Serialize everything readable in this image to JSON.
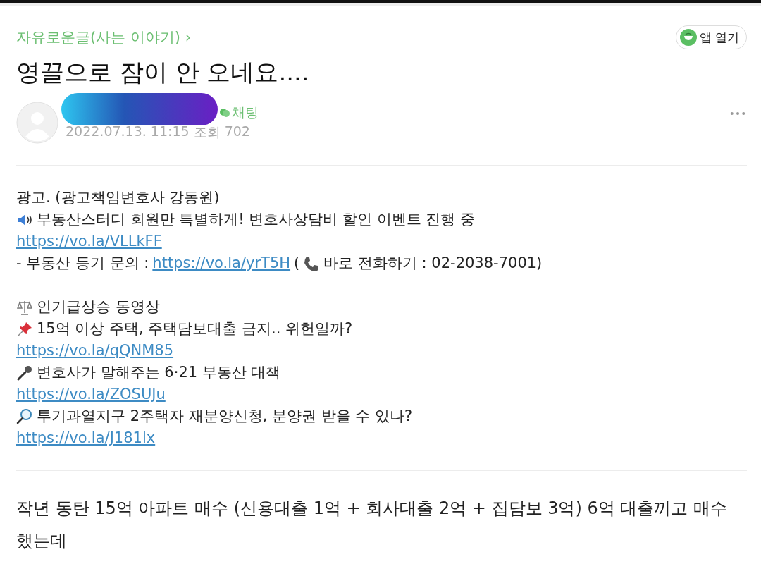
{
  "breadcrumb": "자유로운글(사는 이야기) ›",
  "app_button": "앱 열기",
  "title": "영끌으로 잠이 안 오네요....",
  "author": {
    "chat": "채팅",
    "date": "2022.07.13. 11:15",
    "views_label": "조회",
    "views": "702"
  },
  "ad_blocks": [
    [
      {
        "segments": [
          {
            "kind": "text",
            "text": "광고. (광고책임변호사 강동원)"
          }
        ]
      },
      {
        "segments": [
          {
            "kind": "icon"
          },
          {
            "kind": "text",
            "text": "부동산스터디 회원만 특별하게! 변호사상담비 할인 이벤트 진행 중"
          }
        ]
      },
      {
        "segments": [
          {
            "kind": "link",
            "text": "https://vo.la/VLLkFF"
          }
        ]
      },
      {
        "segments": [
          {
            "kind": "text",
            "text": "- 부동산 등기 문의 :"
          },
          {
            "kind": "link",
            "text": "https://vo.la/yrT5H"
          },
          {
            "kind": "text",
            "text": "("
          },
          {
            "kind": "icon"
          },
          {
            "kind": "text",
            "text": "바로 전화하기 : 02-2038-7001)"
          }
        ]
      }
    ],
    [
      {
        "segments": [
          {
            "kind": "icon"
          },
          {
            "kind": "text",
            "text": "인기급상승 동영상"
          }
        ]
      },
      {
        "segments": [
          {
            "kind": "icon"
          },
          {
            "kind": "text",
            "text": "15억 이상 주택, 주택담보대출 금지.. 위헌일까?"
          }
        ]
      },
      {
        "segments": [
          {
            "kind": "link",
            "text": "https://vo.la/qQNM85"
          }
        ]
      },
      {
        "segments": [
          {
            "kind": "icon"
          },
          {
            "kind": "text",
            "text": "변호사가 말해주는 6·21 부동산 대책"
          }
        ]
      },
      {
        "segments": [
          {
            "kind": "link",
            "text": "https://vo.la/ZOSUJu"
          }
        ]
      },
      {
        "segments": [
          {
            "kind": "icon"
          },
          {
            "kind": "text",
            "text": "투기과열지구 2주택자 재분양신청, 분양권 받을 수 있나?"
          }
        ]
      },
      {
        "segments": [
          {
            "kind": "link",
            "text": "https://vo.la/J181lx"
          }
        ]
      }
    ]
  ],
  "body": "작년 동탄 15억 아파트 매수 (신용대출 1억 + 회사대출 2억 + 집담보 3억) 6억 대출끼고 매수 했는데"
}
